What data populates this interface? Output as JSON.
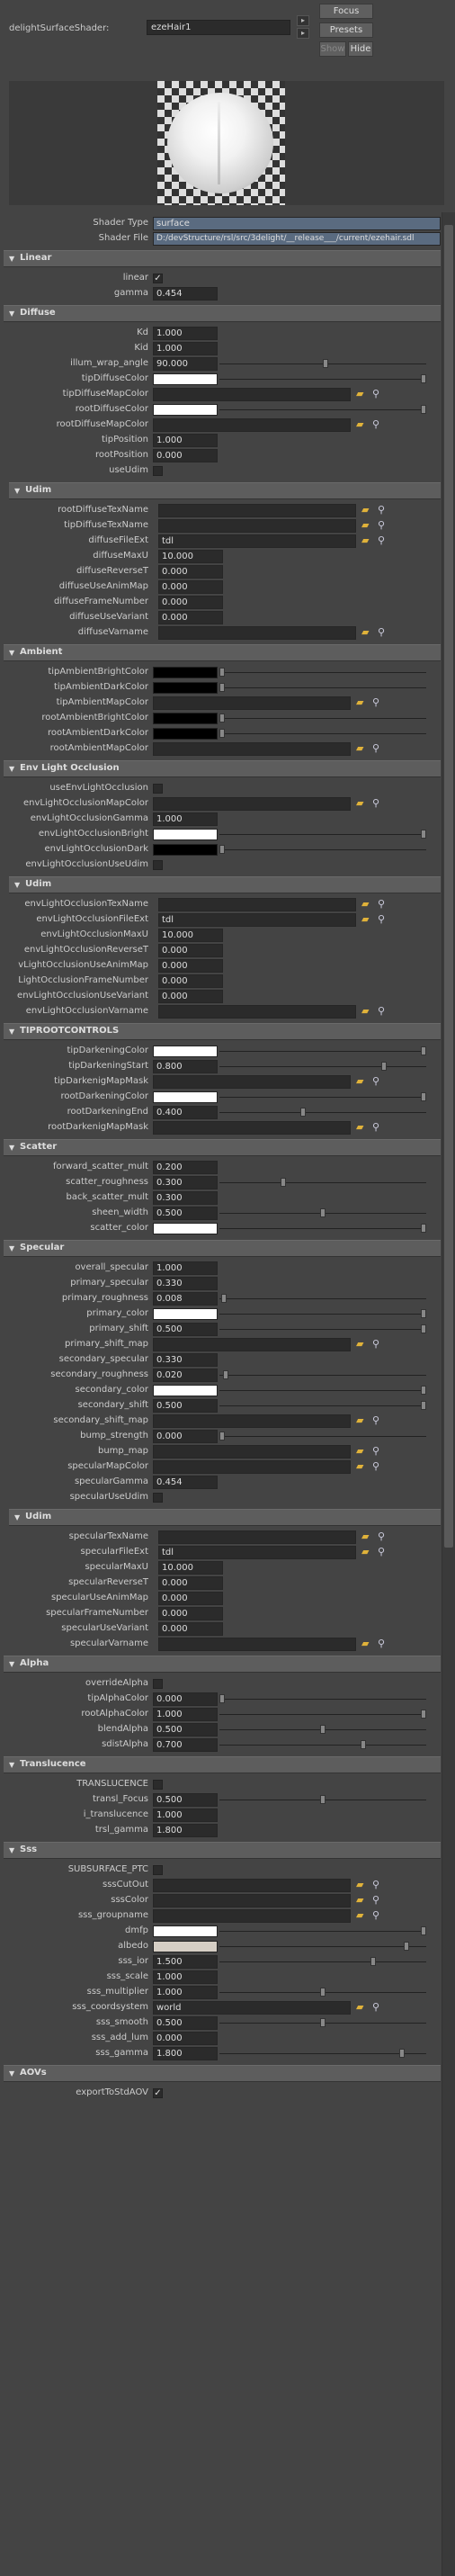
{
  "header": {
    "node_label": "delightSurfaceShader:",
    "node_name": "ezeHair1",
    "focus": "Focus",
    "presets": "Presets",
    "show": "Show",
    "hide": "Hide"
  },
  "shader": {
    "type_label": "Shader Type",
    "type_value": "surface",
    "file_label": "Shader File",
    "file_value": "D:/devStructure/rsl/src/3delight/__release___/current/ezehair.sdl"
  },
  "sections": {
    "linear": "Linear",
    "diffuse": "Diffuse",
    "udim": "Udim",
    "ambient": "Ambient",
    "envocc": "Env Light Occlusion",
    "tiproot": "TIPROOTCONTROLS",
    "scatter": "Scatter",
    "specular": "Specular",
    "alpha": "Alpha",
    "translucence": "Translucence",
    "sss": "Sss",
    "aovs": "AOVs"
  },
  "linear": {
    "linear": "linear",
    "gamma_label": "gamma",
    "gamma": "0.454"
  },
  "diffuse": {
    "kd_label": "Kd",
    "kd": "1.000",
    "kid_label": "Kid",
    "kid": "1.000",
    "illum_label": "illum_wrap_angle",
    "illum": "90.000",
    "tipDiffuseColor": "tipDiffuseColor",
    "tipDiffuseMapColor": "tipDiffuseMapColor",
    "rootDiffuseColor": "rootDiffuseColor",
    "rootDiffuseMapColor": "rootDiffuseMapColor",
    "tipPosition_label": "tipPosition",
    "tipPosition": "1.000",
    "rootPosition_label": "rootPosition",
    "rootPosition": "0.000",
    "useUdim": "useUdim"
  },
  "udim1": {
    "rootName": "rootDiffuseTexName",
    "tipName": "tipDiffuseTexName",
    "fileExt_label": "diffuseFileExt",
    "fileExt": "tdl",
    "maxU_label": "diffuseMaxU",
    "maxU": "10.000",
    "rev_label": "diffuseReverseT",
    "rev": "0.000",
    "anim_label": "diffuseUseAnimMap",
    "anim": "0.000",
    "frame_label": "diffuseFrameNumber",
    "frame": "0.000",
    "var_label": "diffuseUseVariant",
    "var": "0.000",
    "varname": "diffuseVarname"
  },
  "ambient": {
    "tipBright": "tipAmbientBrightColor",
    "tipDark": "tipAmbientDarkColor",
    "tipMap": "tipAmbientMapColor",
    "rootBright": "rootAmbientBrightColor",
    "rootDark": "rootAmbientDarkColor",
    "rootMap": "rootAmbientMapColor"
  },
  "envocc": {
    "use": "useEnvLightOcclusion",
    "map": "envLightOcclusionMapColor",
    "gamma_label": "envLightOcclusionGamma",
    "gamma": "1.000",
    "bright": "envLightOcclusionBright",
    "dark": "envLightOcclusionDark",
    "useUdim": "envLightOcclusionUseUdim"
  },
  "udim2": {
    "name": "envLightOcclusionTexName",
    "fileExt_label": "envLightOcclusionFileExt",
    "fileExt": "tdl",
    "maxU_label": "envLightOcclusionMaxU",
    "maxU": "10.000",
    "rev_label": "envLightOcclusionReverseT",
    "rev": "0.000",
    "anim_label": "vLightOcclusionUseAnimMap",
    "anim": "0.000",
    "frame_label": "LightOcclusionFrameNumber",
    "frame": "0.000",
    "var_label": "envLightOcclusionUseVariant",
    "var": "0.000",
    "varname": "envLightOcclusionVarname"
  },
  "tiproot": {
    "tipDark": "tipDarkeningColor",
    "tipStart_label": "tipDarkeningStart",
    "tipStart": "0.800",
    "tipMask": "tipDarkenigMapMask",
    "rootDark": "rootDarkeningColor",
    "rootEnd_label": "rootDarkeningEnd",
    "rootEnd": "0.400",
    "rootMask": "rootDarkenigMapMask"
  },
  "scatter": {
    "fwd_label": "forward_scatter_mult",
    "fwd": "0.200",
    "rough_label": "scatter_roughness",
    "rough": "0.300",
    "back_label": "back_scatter_mult",
    "back": "0.300",
    "sheen_label": "sheen_width",
    "sheen": "0.500",
    "color": "scatter_color"
  },
  "specular": {
    "overall_label": "overall_specular",
    "overall": "1.000",
    "primary_label": "primary_specular",
    "primary": "0.330",
    "prough_label": "primary_roughness",
    "prough": "0.008",
    "pcolor": "primary_color",
    "pshift_label": "primary_shift",
    "pshift": "0.500",
    "pshiftmap": "primary_shift_map",
    "secondary_label": "secondary_specular",
    "secondary": "0.330",
    "srough_label": "secondary_roughness",
    "srough": "0.020",
    "scolor": "secondary_color",
    "sshift_label": "secondary_shift",
    "sshift": "0.500",
    "sshiftmap": "secondary_shift_map",
    "bump_label": "bump_strength",
    "bump": "0.000",
    "bumpmap": "bump_map",
    "specmap": "specularMapColor",
    "sgamma_label": "specularGamma",
    "sgamma": "0.454",
    "useUdim": "specularUseUdim"
  },
  "udim3": {
    "name": "specularTexName",
    "fileExt_label": "specularFileExt",
    "fileExt": "tdl",
    "maxU_label": "specularMaxU",
    "maxU": "10.000",
    "rev_label": "specularReverseT",
    "rev": "0.000",
    "anim_label": "specularUseAnimMap",
    "anim": "0.000",
    "frame_label": "specularFrameNumber",
    "frame": "0.000",
    "var_label": "specularUseVariant",
    "var": "0.000",
    "varname": "specularVarname"
  },
  "alpha": {
    "override": "overrideAlpha",
    "tip_label": "tipAlphaColor",
    "tip": "0.000",
    "root_label": "rootAlphaColor",
    "root": "1.000",
    "blend_label": "blendAlpha",
    "blend": "0.500",
    "sdist_label": "sdistAlpha",
    "sdist": "0.700"
  },
  "translucence": {
    "trans": "TRANSLUCENCE",
    "focus_label": "transl_Focus",
    "focus": "0.500",
    "i_label": "i_translucence",
    "i": "1.000",
    "gamma_label": "trsl_gamma",
    "gamma": "1.800"
  },
  "sss": {
    "ptc": "SUBSURFACE_PTC",
    "cutout": "sssCutOut",
    "color": "sssColor",
    "group": "sss_groupname",
    "dmfp": "dmfp",
    "albedo": "albedo",
    "ior_label": "sss_ior",
    "ior": "1.500",
    "scale_label": "sss_scale",
    "scale": "1.000",
    "mult_label": "sss_multiplier",
    "mult": "1.000",
    "coord_label": "sss_coordsystem",
    "coord": "world",
    "smooth_label": "sss_smooth",
    "smooth": "0.500",
    "lum_label": "sss_add_lum",
    "lum": "0.000",
    "gamma_label": "sss_gamma",
    "gamma": "1.800"
  },
  "aovs": {
    "export": "exportToStdAOV"
  },
  "colors": {
    "white": "#ffffff",
    "black": "#000000",
    "albedo": "#d6cfc5"
  }
}
